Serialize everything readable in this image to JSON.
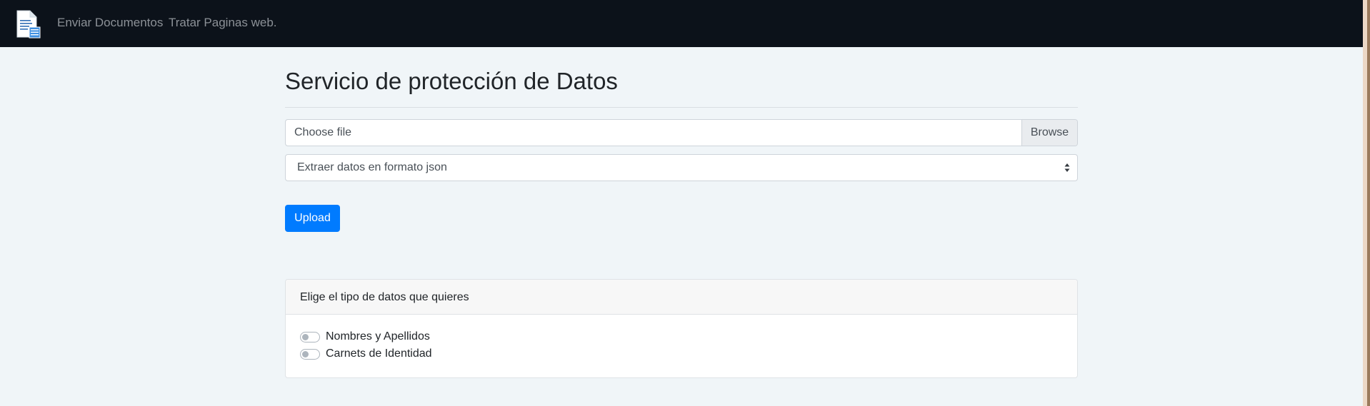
{
  "navbar": {
    "brand_icon": "document-icon",
    "links": [
      {
        "label": "Enviar Documentos"
      },
      {
        "label": "Tratar Paginas web."
      }
    ]
  },
  "main": {
    "title": "Servicio de protección de Datos",
    "file_input": {
      "label": "Choose file",
      "browse_label": "Browse"
    },
    "select": {
      "value": "Extraer datos en formato json"
    },
    "upload_label": "Upload",
    "card": {
      "title": "Elige el tipo de datos que quieres",
      "options": [
        {
          "label": "Nombres y Apellidos",
          "checked": false
        },
        {
          "label": "Carnets de Identidad",
          "checked": false
        }
      ]
    }
  },
  "colors": {
    "navbar": "#0c121a",
    "background": "#f0f5f8",
    "primary": "#007bff"
  }
}
